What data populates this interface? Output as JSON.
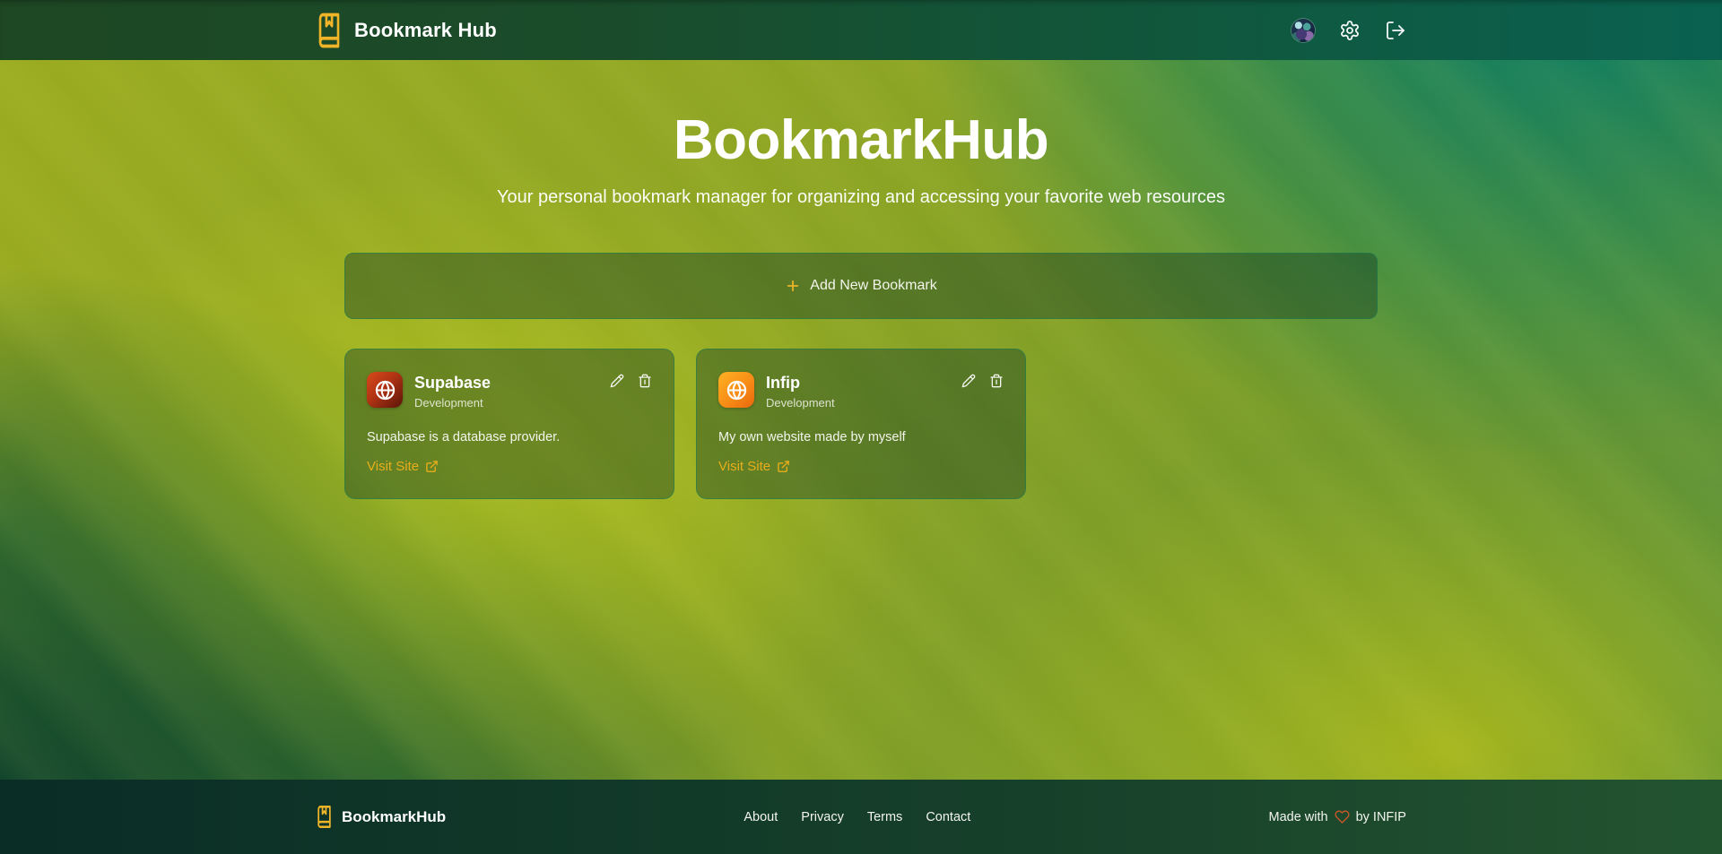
{
  "header": {
    "brand": "Bookmark Hub",
    "icons": {
      "avatar": "user-avatar",
      "settings": "gear-icon",
      "logout": "log-out-icon"
    }
  },
  "hero": {
    "title": "BookmarkHub",
    "subtitle": "Your personal bookmark manager for organizing and accessing your favorite web resources"
  },
  "actions": {
    "add_label": "Add New Bookmark",
    "plus": "plus-icon"
  },
  "bookmarks": [
    {
      "title": "Supabase",
      "category": "Development",
      "description": "Supabase is a database provider.",
      "link_label": "Visit Site",
      "icon": "globe-icon",
      "icon_style": "background:linear-gradient(135deg,#d84a1b 0%,#b03313 45%,#5a140a 100%)"
    },
    {
      "title": "Infip",
      "category": "Development",
      "description": "My own website made by myself",
      "link_label": "Visit Site",
      "icon": "globe-icon",
      "icon_style": "background:linear-gradient(135deg,#ffb123 0%,#f88d16 55%,#e8660d 100%)"
    }
  ],
  "footer": {
    "brand": "BookmarkHub",
    "links": [
      "About",
      "Privacy",
      "Terms",
      "Contact"
    ],
    "made_prefix": "Made with",
    "made_suffix": "by INFIP"
  },
  "colors": {
    "brand_gold": "#f0b429",
    "link_gold": "#e9ad1c",
    "heart_outline": "#c65628",
    "header_gradient": [
      "#1e4723",
      "#0a6150"
    ],
    "footer_gradient": [
      "#0a2d26",
      "#235430"
    ],
    "background_yellow_green": "#96a822",
    "background_teal": "#087a66",
    "background_dark_teal": "#04352b",
    "card_overlay": "rgba(15,57,38,0.40)",
    "card_border": "rgba(26,125,86,0.55)"
  }
}
